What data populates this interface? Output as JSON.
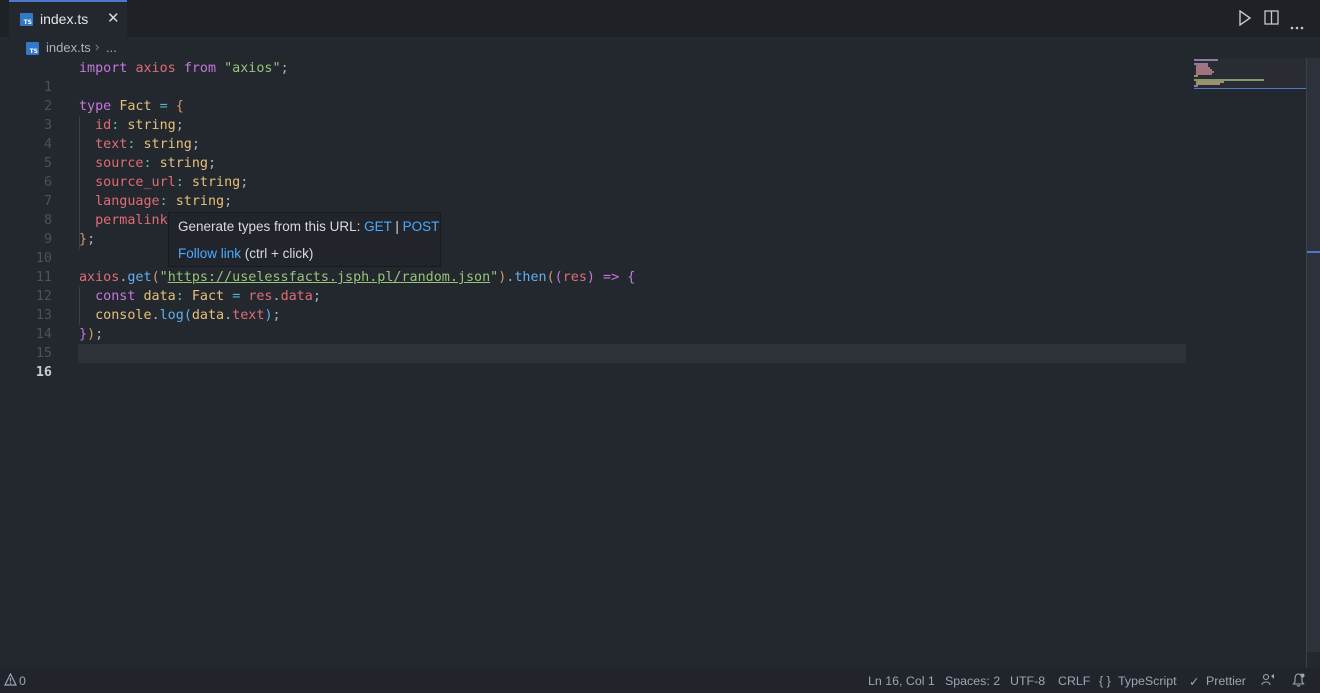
{
  "tab": {
    "filename": "index.ts",
    "close_glyph": "✕"
  },
  "breadcrumb": {
    "file": "index.ts",
    "separator": "›",
    "more": "..."
  },
  "editor": {
    "active_line": 16,
    "lines": [
      {
        "n": "1"
      },
      {
        "n": "2"
      },
      {
        "n": "3"
      },
      {
        "n": "4"
      },
      {
        "n": "5"
      },
      {
        "n": "6"
      },
      {
        "n": "7"
      },
      {
        "n": "8"
      },
      {
        "n": "9"
      },
      {
        "n": "10"
      },
      {
        "n": "11"
      },
      {
        "n": "12"
      },
      {
        "n": "13"
      },
      {
        "n": "14"
      },
      {
        "n": "15"
      },
      {
        "n": "16"
      }
    ],
    "tokens": {
      "l1": [
        "import",
        "axios",
        "from",
        "\"axios\"",
        ";"
      ],
      "l3": [
        "type",
        "Fact",
        "=",
        "{"
      ],
      "l4": [
        "id",
        ":",
        "string",
        ";"
      ],
      "l5": [
        "text",
        ":",
        "string",
        ";"
      ],
      "l6": [
        "source",
        ":",
        "string",
        ";"
      ],
      "l7": [
        "source_url",
        ":",
        "string",
        ";"
      ],
      "l8": [
        "language",
        ":",
        "string",
        ";"
      ],
      "l9": [
        "permalink"
      ],
      "l10": [
        "}",
        ";"
      ],
      "l12": [
        "axios",
        ".",
        "get",
        "(",
        "\"",
        "https://uselessfacts.jsph.pl/random.json",
        "\"",
        ")",
        ".",
        "then",
        "(",
        "(",
        "res",
        ")",
        "=>",
        "{"
      ],
      "l13": [
        "const",
        "data",
        ":",
        "Fact",
        "=",
        "res",
        ".",
        "data",
        ";"
      ],
      "l14": [
        "console",
        ".",
        "log",
        "(",
        "data",
        ".",
        "text",
        ")",
        ";"
      ],
      "l15": [
        "}",
        ")",
        ";"
      ]
    }
  },
  "hover": {
    "prefix": "Generate types from this URL: ",
    "get": "GET",
    "sep": " | ",
    "post": "POST",
    "follow": "Follow link",
    "follow_hint": " (ctrl + click)"
  },
  "toolbar": {
    "run_icon": "run-icon",
    "split_icon": "split-editor-icon",
    "more_icon": "more-icon"
  },
  "status": {
    "problems_count": "0",
    "position": "Ln 16, Col 1",
    "spaces": "Spaces: 2",
    "encoding": "UTF-8",
    "eol": "CRLF",
    "language_icon": "{ }",
    "language": "TypeScript",
    "prettier_icon": "✓",
    "prettier": "Prettier"
  },
  "colors": {
    "keyword": "#c678dd",
    "variable": "#e06c75",
    "type": "#e5c07b",
    "string": "#98c379",
    "function": "#61afef",
    "operator": "#56b6c2",
    "link": "#4daafc",
    "accent": "#4d78cc"
  }
}
